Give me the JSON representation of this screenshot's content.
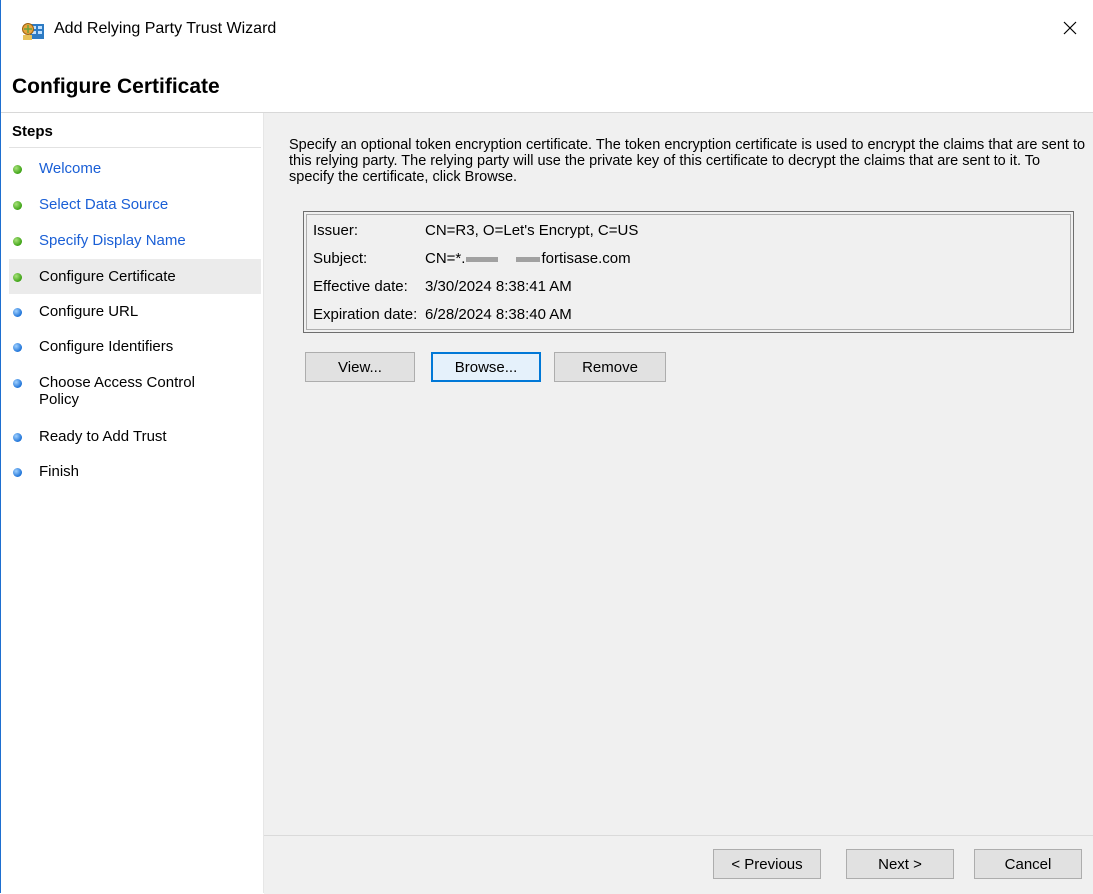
{
  "window": {
    "title": "Add Relying Party Trust Wizard"
  },
  "header": {
    "page_title": "Configure Certificate"
  },
  "steps": {
    "heading": "Steps",
    "items": [
      {
        "label": "Welcome",
        "status": "completed"
      },
      {
        "label": "Select Data Source",
        "status": "completed"
      },
      {
        "label": "Specify Display Name",
        "status": "completed"
      },
      {
        "label": "Configure Certificate",
        "status": "current"
      },
      {
        "label": "Configure URL",
        "status": "pending"
      },
      {
        "label": "Configure Identifiers",
        "status": "pending"
      },
      {
        "label": "Choose Access Control Policy",
        "status": "pending"
      },
      {
        "label": "Ready to Add Trust",
        "status": "pending"
      },
      {
        "label": "Finish",
        "status": "pending"
      }
    ]
  },
  "content": {
    "description": "Specify an optional token encryption certificate.  The token encryption certificate is used to encrypt the claims that are sent to this relying party.  The relying party will use the private key of this certificate to decrypt the claims that are sent to it.  To specify the certificate, click Browse.",
    "certificate": {
      "issuer_label": "Issuer:",
      "issuer_value": "CN=R3, O=Let's Encrypt, C=US",
      "subject_label": "Subject:",
      "subject_prefix": "CN=*.",
      "subject_suffix": "fortisase.com",
      "effective_label": "Effective date:",
      "effective_value": "3/30/2024 8:38:41 AM",
      "expiration_label": "Expiration date:",
      "expiration_value": "6/28/2024 8:38:40 AM"
    },
    "buttons": {
      "view": "View...",
      "browse": "Browse...",
      "remove": "Remove"
    }
  },
  "footer": {
    "previous": "< Previous",
    "next": "Next >",
    "cancel": "Cancel"
  },
  "colors": {
    "completed_dot": "#3ea316",
    "pending_dot": "#1f74d8",
    "link_text": "#1a5fd6",
    "focus_border": "#0078d7"
  },
  "icons": {
    "app": "adfs-wizard-icon",
    "close": "close-icon"
  }
}
